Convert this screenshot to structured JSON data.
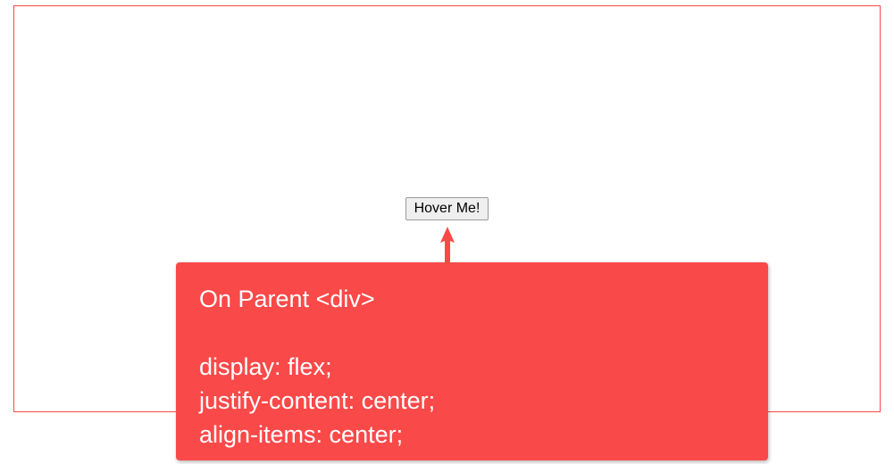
{
  "button": {
    "label": "Hover Me!"
  },
  "annotation": {
    "title": "On Parent <div>",
    "lines": [
      "display: flex;",
      "justify-content: center;",
      "align-items: center;"
    ]
  },
  "colors": {
    "accent": "#fa4949"
  }
}
